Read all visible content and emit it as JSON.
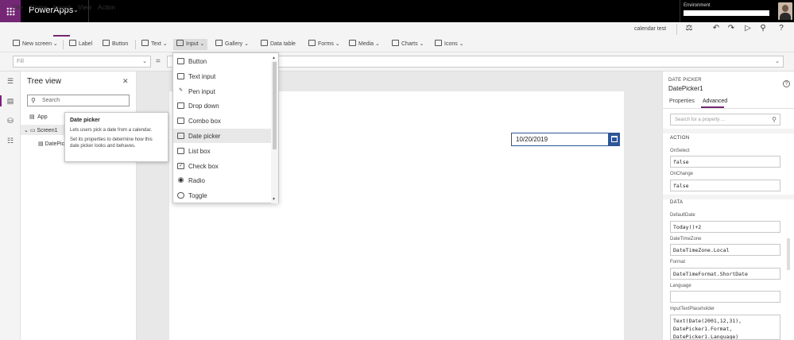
{
  "app": {
    "title": "PowerApps",
    "environment_label": "Environment",
    "file_name": "calendar test"
  },
  "colors": {
    "brand": "#742774",
    "accent_blue": "#2f5597"
  },
  "menu": {
    "items": [
      "File",
      "Home",
      "Insert",
      "View",
      "Action"
    ],
    "active": "Insert"
  },
  "ribbon": {
    "new_screen": "New screen",
    "label": "Label",
    "button": "Button",
    "text": "Text",
    "input": "Input",
    "gallery": "Gallery",
    "data_table": "Data table",
    "forms": "Forms",
    "media": "Media",
    "charts": "Charts",
    "icons": "Icons"
  },
  "formula": {
    "property": "Fill",
    "equals": "=",
    "value": ""
  },
  "tree": {
    "title": "Tree view",
    "search_placeholder": "Search",
    "app_node": "App",
    "screen_node": "Screen1",
    "control_node": "DatePic"
  },
  "tooltip": {
    "title": "Date picker",
    "line1": "Lets users pick a date from a calendar.",
    "line2": "Set its properties to determine how this date picker looks and behaves."
  },
  "input_menu": {
    "items": [
      {
        "label": "Button",
        "icon": "button-icon"
      },
      {
        "label": "Text input",
        "icon": "text-input-icon"
      },
      {
        "label": "Pen input",
        "icon": "pen-input-icon"
      },
      {
        "label": "Drop down",
        "icon": "drop-down-icon"
      },
      {
        "label": "Combo box",
        "icon": "combo-box-icon"
      },
      {
        "label": "Date picker",
        "icon": "date-picker-icon"
      },
      {
        "label": "List box",
        "icon": "list-box-icon"
      },
      {
        "label": "Check box",
        "icon": "check-box-icon"
      },
      {
        "label": "Radio",
        "icon": "radio-icon"
      },
      {
        "label": "Toggle",
        "icon": "toggle-icon"
      }
    ],
    "highlighted": "Date picker"
  },
  "canvas": {
    "date_value": "10/20/2019"
  },
  "properties": {
    "control_type": "DATE PICKER",
    "control_name": "DatePicker1",
    "tab_properties": "Properties",
    "tab_advanced": "Advanced",
    "search_placeholder": "Search for a property ...",
    "section_action": "ACTION",
    "onselect_label": "OnSelect",
    "onselect_value": "false",
    "onchange_label": "OnChange",
    "onchange_value": "false",
    "section_data": "DATA",
    "defaultdate_label": "DefaultDate",
    "defaultdate_value": "Today()+2",
    "datetimezone_label": "DateTimeZone",
    "datetimezone_value": "DateTimeZone.Local",
    "format_label": "Format",
    "format_value": "DateTimeFormat.ShortDate",
    "language_label": "Language",
    "language_value": "",
    "placeholder_label": "InputTextPlaceholder",
    "placeholder_value": "Text(Date(2001,12,31),\nDatePicker1.Format,\nDatePicker1.Language)"
  }
}
